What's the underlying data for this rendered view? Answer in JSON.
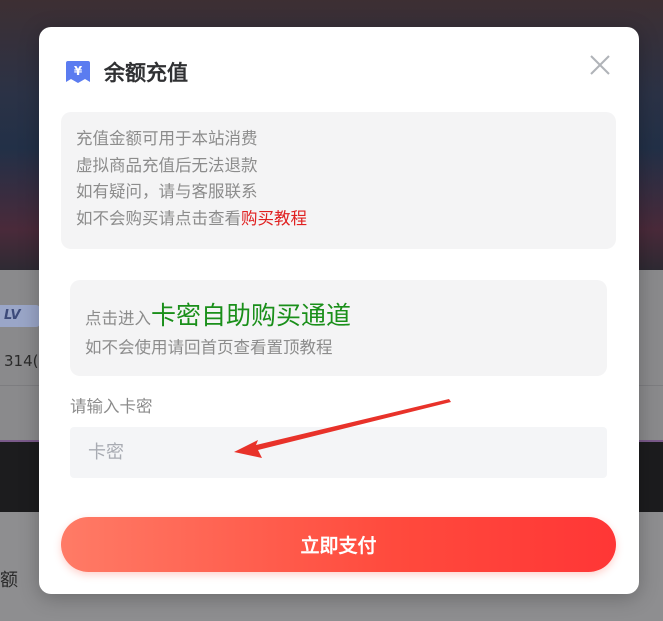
{
  "background": {
    "badge_text": "LV",
    "partial_text_1": "314(",
    "partial_text_2": "额"
  },
  "modal": {
    "title": "余额充值",
    "title_icon": "yen-wallet-icon",
    "close_icon": "close-icon",
    "notice": {
      "line1": "充值金额可用于本站消费",
      "line2": "虚拟商品充值后无法退款",
      "line3": "如有疑问，请与客服联系",
      "line4_prefix": "如不会购买请点击查看",
      "line4_link": "购买教程"
    },
    "purchase": {
      "prefix": "点击进入",
      "link": "卡密自助购买通道",
      "hint": "如不会使用请回首页查看置顶教程"
    },
    "field_label": "请输入卡密",
    "input_placeholder": "卡密",
    "input_value": "",
    "pay_button": "立即支付"
  },
  "colors": {
    "link_red": "#e02020",
    "link_green": "#1a8f1a",
    "button_gradient_start": "#ff7b66",
    "button_gradient_end": "#ff3636",
    "annotation_arrow": "#e8322a"
  }
}
